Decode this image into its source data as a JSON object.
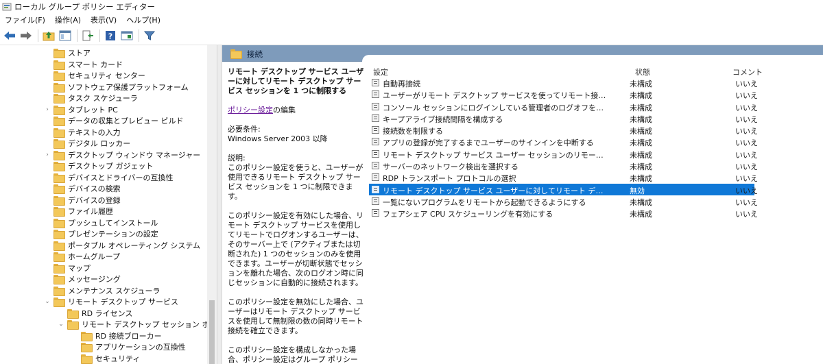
{
  "window": {
    "title": "ローカル グループ ポリシー エディター"
  },
  "menu": [
    "ファイル(F)",
    "操作(A)",
    "表示(V)",
    "ヘルプ(H)"
  ],
  "toolbar": {
    "buttons": [
      "back-arrow-icon",
      "forward-arrow-icon",
      "up-folder-icon",
      "show-tree-icon",
      "export-list-icon",
      "help-icon",
      "properties-icon",
      "filter-icon"
    ]
  },
  "tree": {
    "items": [
      {
        "label": "ストア",
        "chevron": ""
      },
      {
        "label": "スマート カード",
        "chevron": ""
      },
      {
        "label": "セキュリティ センター",
        "chevron": ""
      },
      {
        "label": "ソフトウェア保護プラットフォーム",
        "chevron": ""
      },
      {
        "label": "タスク スケジューラ",
        "chevron": ""
      },
      {
        "label": "タブレット PC",
        "chevron": "›"
      },
      {
        "label": "データの収集とプレビュー ビルド",
        "chevron": ""
      },
      {
        "label": "テキストの入力",
        "chevron": ""
      },
      {
        "label": "デジタル ロッカー",
        "chevron": ""
      },
      {
        "label": "デスクトップ ウィンドウ マネージャー",
        "chevron": "›"
      },
      {
        "label": "デスクトップ ガジェット",
        "chevron": ""
      },
      {
        "label": "デバイスとドライバーの互換性",
        "chevron": ""
      },
      {
        "label": "デバイスの検索",
        "chevron": ""
      },
      {
        "label": "デバイスの登録",
        "chevron": ""
      },
      {
        "label": "ファイル履歴",
        "chevron": ""
      },
      {
        "label": "プッシュしてインストール",
        "chevron": ""
      },
      {
        "label": "プレゼンテーションの設定",
        "chevron": ""
      },
      {
        "label": "ポータブル オペレーティング システム",
        "chevron": ""
      },
      {
        "label": "ホームグループ",
        "chevron": ""
      },
      {
        "label": "マップ",
        "chevron": ""
      },
      {
        "label": "メッセージング",
        "chevron": ""
      },
      {
        "label": "メンテナンス スケジューラ",
        "chevron": ""
      },
      {
        "label": "リモート デスクトップ サービス",
        "chevron": "⌄"
      },
      {
        "label": "RD ライセンス",
        "chevron": ""
      },
      {
        "label": "リモート デスクトップ セッション ホスト",
        "chevron": "⌄"
      },
      {
        "label": "RD 接続ブローカー",
        "chevron": ""
      },
      {
        "label": "アプリケーションの互換性",
        "chevron": ""
      },
      {
        "label": "セキュリティ",
        "chevron": ""
      }
    ]
  },
  "header": {
    "title": "接続"
  },
  "description": {
    "title": "リモート デスクトップ サービス ユーザーに対してリモート デスクトップ サービス セッションを 1 つに制限する",
    "edit_link": "ポリシー設定",
    "edit_suffix": "の編集",
    "req_label": "必要条件:",
    "req_value": "Windows Server 2003 以降",
    "expl_label": "説明:",
    "p1": "このポリシー設定を使うと、ユーザーが使用できるリモート デスクトップ サービス セッションを 1 つに制限できます。",
    "p2": "このポリシー設定を有効にした場合、リモート デスクトップ サービスを使用してリモートでログオンするユーザーは、そのサーバー上で (アクティブまたは切断された) 1 つのセッションのみを使用できます。ユーザーが切断状態でセッションを離れた場合、次のログオン時に同じセッションに自動的に接続されます。",
    "p3": "このポリシー設定を無効にした場合、ユーザーはリモート デスクトップ サービスを使用して無制限の数の同時リモート接続を確立できます。",
    "p4": "このポリシー設定を構成しなかった場合、ポリシー設定はグループ ポリシー レベルでは指定されません。"
  },
  "list": {
    "columns": {
      "setting": "設定",
      "state": "状態",
      "comment": "コメント"
    },
    "rows": [
      {
        "name": "自動再接続",
        "state": "未構成",
        "comment": "いいえ",
        "selected": false
      },
      {
        "name": "ユーザーがリモート デスクトップ サービスを使ってリモート接続することを許...",
        "state": "未構成",
        "comment": "いいえ",
        "selected": false
      },
      {
        "name": "コンソール セッションにログインしている管理者のログオフを拒否する",
        "state": "未構成",
        "comment": "いいえ",
        "selected": false
      },
      {
        "name": "キープアライブ接続間隔を構成する",
        "state": "未構成",
        "comment": "いいえ",
        "selected": false
      },
      {
        "name": "接続数を制限する",
        "state": "未構成",
        "comment": "いいえ",
        "selected": false
      },
      {
        "name": "アプリの登録が完了するまでユーザーのサインインを中断する",
        "state": "未構成",
        "comment": "いいえ",
        "selected": false
      },
      {
        "name": "リモート デスクトップ サービス ユーザー セッションのリモート制御のルール...",
        "state": "未構成",
        "comment": "いいえ",
        "selected": false
      },
      {
        "name": "サーバーのネットワーク検出を選択する",
        "state": "未構成",
        "comment": "いいえ",
        "selected": false
      },
      {
        "name": "RDP トランスポート プロトコルの選択",
        "state": "未構成",
        "comment": "いいえ",
        "selected": false
      },
      {
        "name": "リモート デスクトップ サービス ユーザーに対してリモート デスクトップ サービ...",
        "state": "無効",
        "comment": "いいえ",
        "selected": true
      },
      {
        "name": "一覧にないプログラムをリモートから起動できるようにする",
        "state": "未構成",
        "comment": "いいえ",
        "selected": false
      },
      {
        "name": "フェアシェア CPU スケジューリングを有効にする",
        "state": "未構成",
        "comment": "いいえ",
        "selected": false
      }
    ]
  },
  "colors": {
    "header_band": "#7e9bbb",
    "selection": "#0f78d7",
    "link": "#6a1b9a",
    "folder": "#f3c85a"
  }
}
